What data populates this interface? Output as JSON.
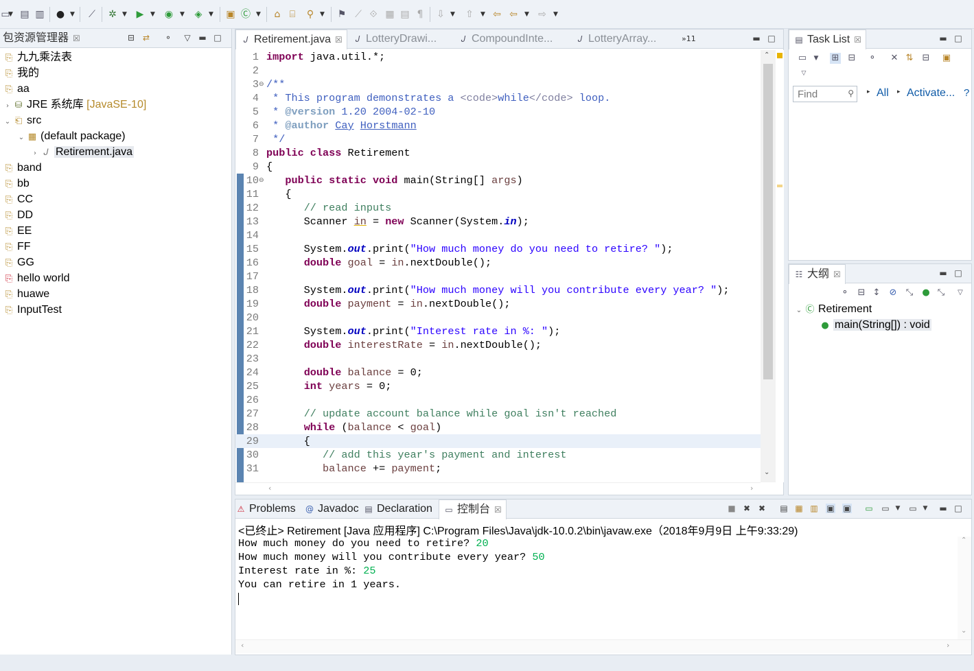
{
  "toolbar": {
    "icons": [
      "new-icon",
      "save-icon",
      "save-all-icon",
      "debug-skip-icon",
      "skip-breakpoints-icon",
      "debug-icon",
      "run-icon",
      "coverage-icon",
      "external-tools-icon",
      "new-java-project-icon",
      "new-package-icon",
      "new-class-icon",
      "open-type-icon",
      "open-task-icon",
      "search-icon",
      "annotation-icon",
      "toggle-mark-icon",
      "block-selection-icon",
      "show-whitespace-icon",
      "next-annotation-icon",
      "prev-annotation-icon",
      "last-edit-icon",
      "back-icon",
      "forward-icon"
    ]
  },
  "package_explorer": {
    "title": "包资源管理器",
    "close": "☒",
    "items": [
      {
        "label": "九九乘法表"
      },
      {
        "label": "我的"
      },
      {
        "label": "aa"
      },
      {
        "label": "JRE 系统库",
        "decoration": "[JavaSE-10]"
      },
      {
        "label": "src"
      },
      {
        "label": "(default package)"
      },
      {
        "label": "Retirement.java"
      },
      {
        "label": "band"
      },
      {
        "label": "bb"
      },
      {
        "label": "CC"
      },
      {
        "label": "DD"
      },
      {
        "label": "EE"
      },
      {
        "label": "FF"
      },
      {
        "label": "GG"
      },
      {
        "label": "hello world"
      },
      {
        "label": "huawe"
      },
      {
        "label": "InputTest"
      }
    ]
  },
  "editor": {
    "tabs": [
      {
        "label": "Retirement.java"
      },
      {
        "label": "LotteryDrawi..."
      },
      {
        "label": "CompoundInte..."
      },
      {
        "label": "LotteryArray..."
      }
    ],
    "overflow": "»11",
    "line_numbers": [
      "1",
      "2",
      "3",
      "4",
      "5",
      "6",
      "7",
      "8",
      "9",
      "10",
      "11",
      "12",
      "13",
      "14",
      "15",
      "16",
      "17",
      "18",
      "19",
      "20",
      "21",
      "22",
      "23",
      "24",
      "25",
      "26",
      "27",
      "28",
      "29",
      "30",
      "31"
    ]
  },
  "task_list": {
    "title": "Task List",
    "find_placeholder": "Find",
    "all_label": "All",
    "activate_label": "Activate...",
    "help": "?"
  },
  "outline": {
    "title": "大纲",
    "class_name": "Retirement",
    "method": "main(String[]) : void"
  },
  "console": {
    "tabs": [
      {
        "label": "Problems"
      },
      {
        "label": "Javadoc"
      },
      {
        "label": "Declaration"
      },
      {
        "label": "控制台"
      }
    ],
    "header": "<已终止> Retirement [Java 应用程序] C:\\Program Files\\Java\\jdk-10.0.2\\bin\\javaw.exe（2018年9月9日 上午9:33:29)",
    "lines": [
      {
        "prompt": "How much money do you need to retire? ",
        "input": "20"
      },
      {
        "prompt": "How much money will you contribute every year? ",
        "input": "50"
      },
      {
        "prompt": "Interest rate in %: ",
        "input": "25"
      },
      {
        "prompt": "You can retire in 1 years.",
        "input": ""
      }
    ]
  }
}
